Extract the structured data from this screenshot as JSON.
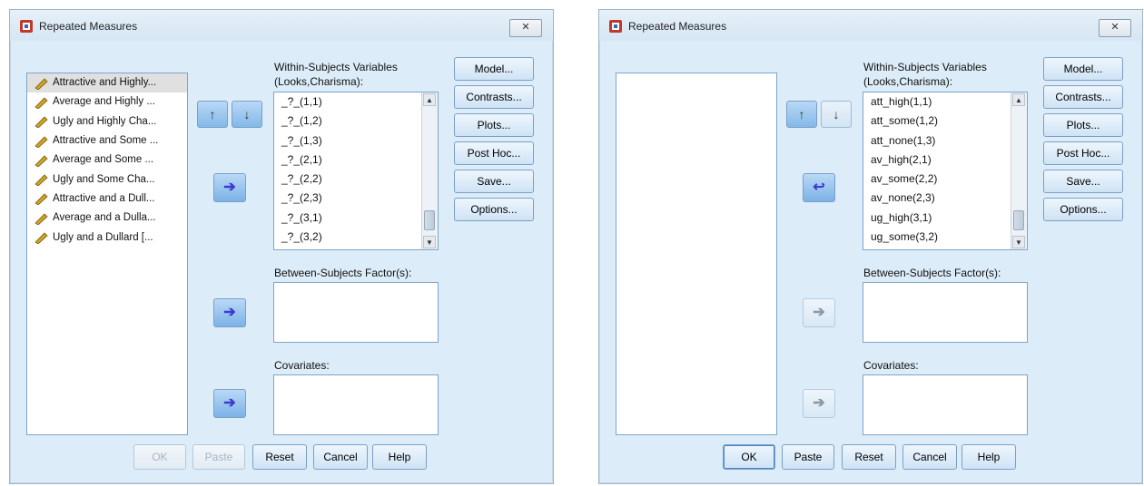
{
  "left_dialog": {
    "title": "Repeated Measures",
    "close_label": "✕",
    "variables": [
      "Attractive and Highly...",
      "Average and Highly ...",
      "Ugly and Highly Cha...",
      "Attractive and Some ...",
      "Average and Some ...",
      "Ugly and Some Cha...",
      "Attractive and a Dull...",
      "Average and a Dulla...",
      "Ugly and a Dullard [..."
    ],
    "within_label_1": "Within-Subjects Variables",
    "within_label_2": "(Looks,Charisma):",
    "within_items": [
      "_?_(1,1)",
      "_?_(1,2)",
      "_?_(1,3)",
      "_?_(2,1)",
      "_?_(2,2)",
      "_?_(2,3)",
      "_?_(3,1)",
      "_?_(3,2)"
    ],
    "between_label": "Between-Subjects Factor(s):",
    "covariates_label": "Covariates:",
    "side_buttons": [
      "Model...",
      "Contrasts...",
      "Plots...",
      "Post Hoc...",
      "Save...",
      "Options..."
    ],
    "bottom_buttons": [
      "OK",
      "Paste",
      "Reset",
      "Cancel",
      "Help"
    ]
  },
  "right_dialog": {
    "title": "Repeated Measures",
    "close_label": "✕",
    "within_label_1": "Within-Subjects Variables",
    "within_label_2": "(Looks,Charisma):",
    "within_items": [
      "att_high(1,1)",
      "att_some(1,2)",
      "att_none(1,3)",
      "av_high(2,1)",
      "av_some(2,2)",
      "av_none(2,3)",
      "ug_high(3,1)",
      "ug_some(3,2)"
    ],
    "between_label": "Between-Subjects Factor(s):",
    "covariates_label": "Covariates:",
    "side_buttons": [
      "Model...",
      "Contrasts...",
      "Plots...",
      "Post Hoc...",
      "Save...",
      "Options..."
    ],
    "bottom_buttons": [
      "OK",
      "Paste",
      "Reset",
      "Cancel",
      "Help"
    ]
  },
  "icons": {
    "up": "↑",
    "down": "↓",
    "move_right": "➔",
    "move_left": "↩",
    "scroll_up": "▲",
    "scroll_down": "▼"
  }
}
